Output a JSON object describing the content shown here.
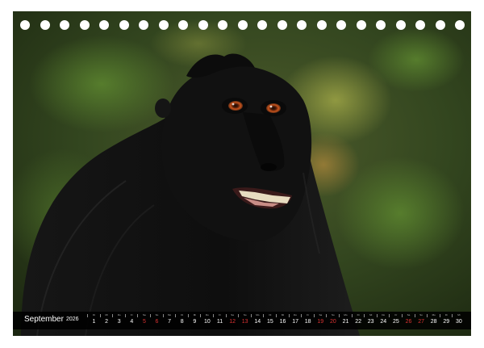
{
  "calendar": {
    "month": "September",
    "year": "2026",
    "days": [
      {
        "num": "1",
        "dow": "Di",
        "weekend": false
      },
      {
        "num": "2",
        "dow": "Mi",
        "weekend": false
      },
      {
        "num": "3",
        "dow": "Do",
        "weekend": false
      },
      {
        "num": "4",
        "dow": "Fr",
        "weekend": false
      },
      {
        "num": "5",
        "dow": "Sa",
        "weekend": true
      },
      {
        "num": "6",
        "dow": "So",
        "weekend": true
      },
      {
        "num": "7",
        "dow": "Mo",
        "weekend": false
      },
      {
        "num": "8",
        "dow": "Di",
        "weekend": false
      },
      {
        "num": "9",
        "dow": "Mi",
        "weekend": false
      },
      {
        "num": "10",
        "dow": "Do",
        "weekend": false
      },
      {
        "num": "11",
        "dow": "Fr",
        "weekend": false
      },
      {
        "num": "12",
        "dow": "Sa",
        "weekend": true
      },
      {
        "num": "13",
        "dow": "So",
        "weekend": true
      },
      {
        "num": "14",
        "dow": "Mo",
        "weekend": false
      },
      {
        "num": "15",
        "dow": "Di",
        "weekend": false
      },
      {
        "num": "16",
        "dow": "Mi",
        "weekend": false
      },
      {
        "num": "17",
        "dow": "Do",
        "weekend": false
      },
      {
        "num": "18",
        "dow": "Fr",
        "weekend": false
      },
      {
        "num": "19",
        "dow": "Sa",
        "weekend": true
      },
      {
        "num": "20",
        "dow": "So",
        "weekend": true
      },
      {
        "num": "21",
        "dow": "Mo",
        "weekend": false
      },
      {
        "num": "22",
        "dow": "Di",
        "weekend": false
      },
      {
        "num": "23",
        "dow": "Mi",
        "weekend": false
      },
      {
        "num": "24",
        "dow": "Do",
        "weekend": false
      },
      {
        "num": "25",
        "dow": "Fr",
        "weekend": false
      },
      {
        "num": "26",
        "dow": "Sa",
        "weekend": true
      },
      {
        "num": "27",
        "dow": "So",
        "weekend": true
      },
      {
        "num": "28",
        "dow": "Mo",
        "weekend": false
      },
      {
        "num": "29",
        "dow": "Di",
        "weekend": false
      },
      {
        "num": "30",
        "dow": "Mi",
        "weekend": false
      }
    ]
  },
  "binding_holes": {
    "count": 23
  },
  "colors": {
    "weekend": "#dd3333",
    "strip": "#000000",
    "background_foliage": "#2c3a1e"
  }
}
